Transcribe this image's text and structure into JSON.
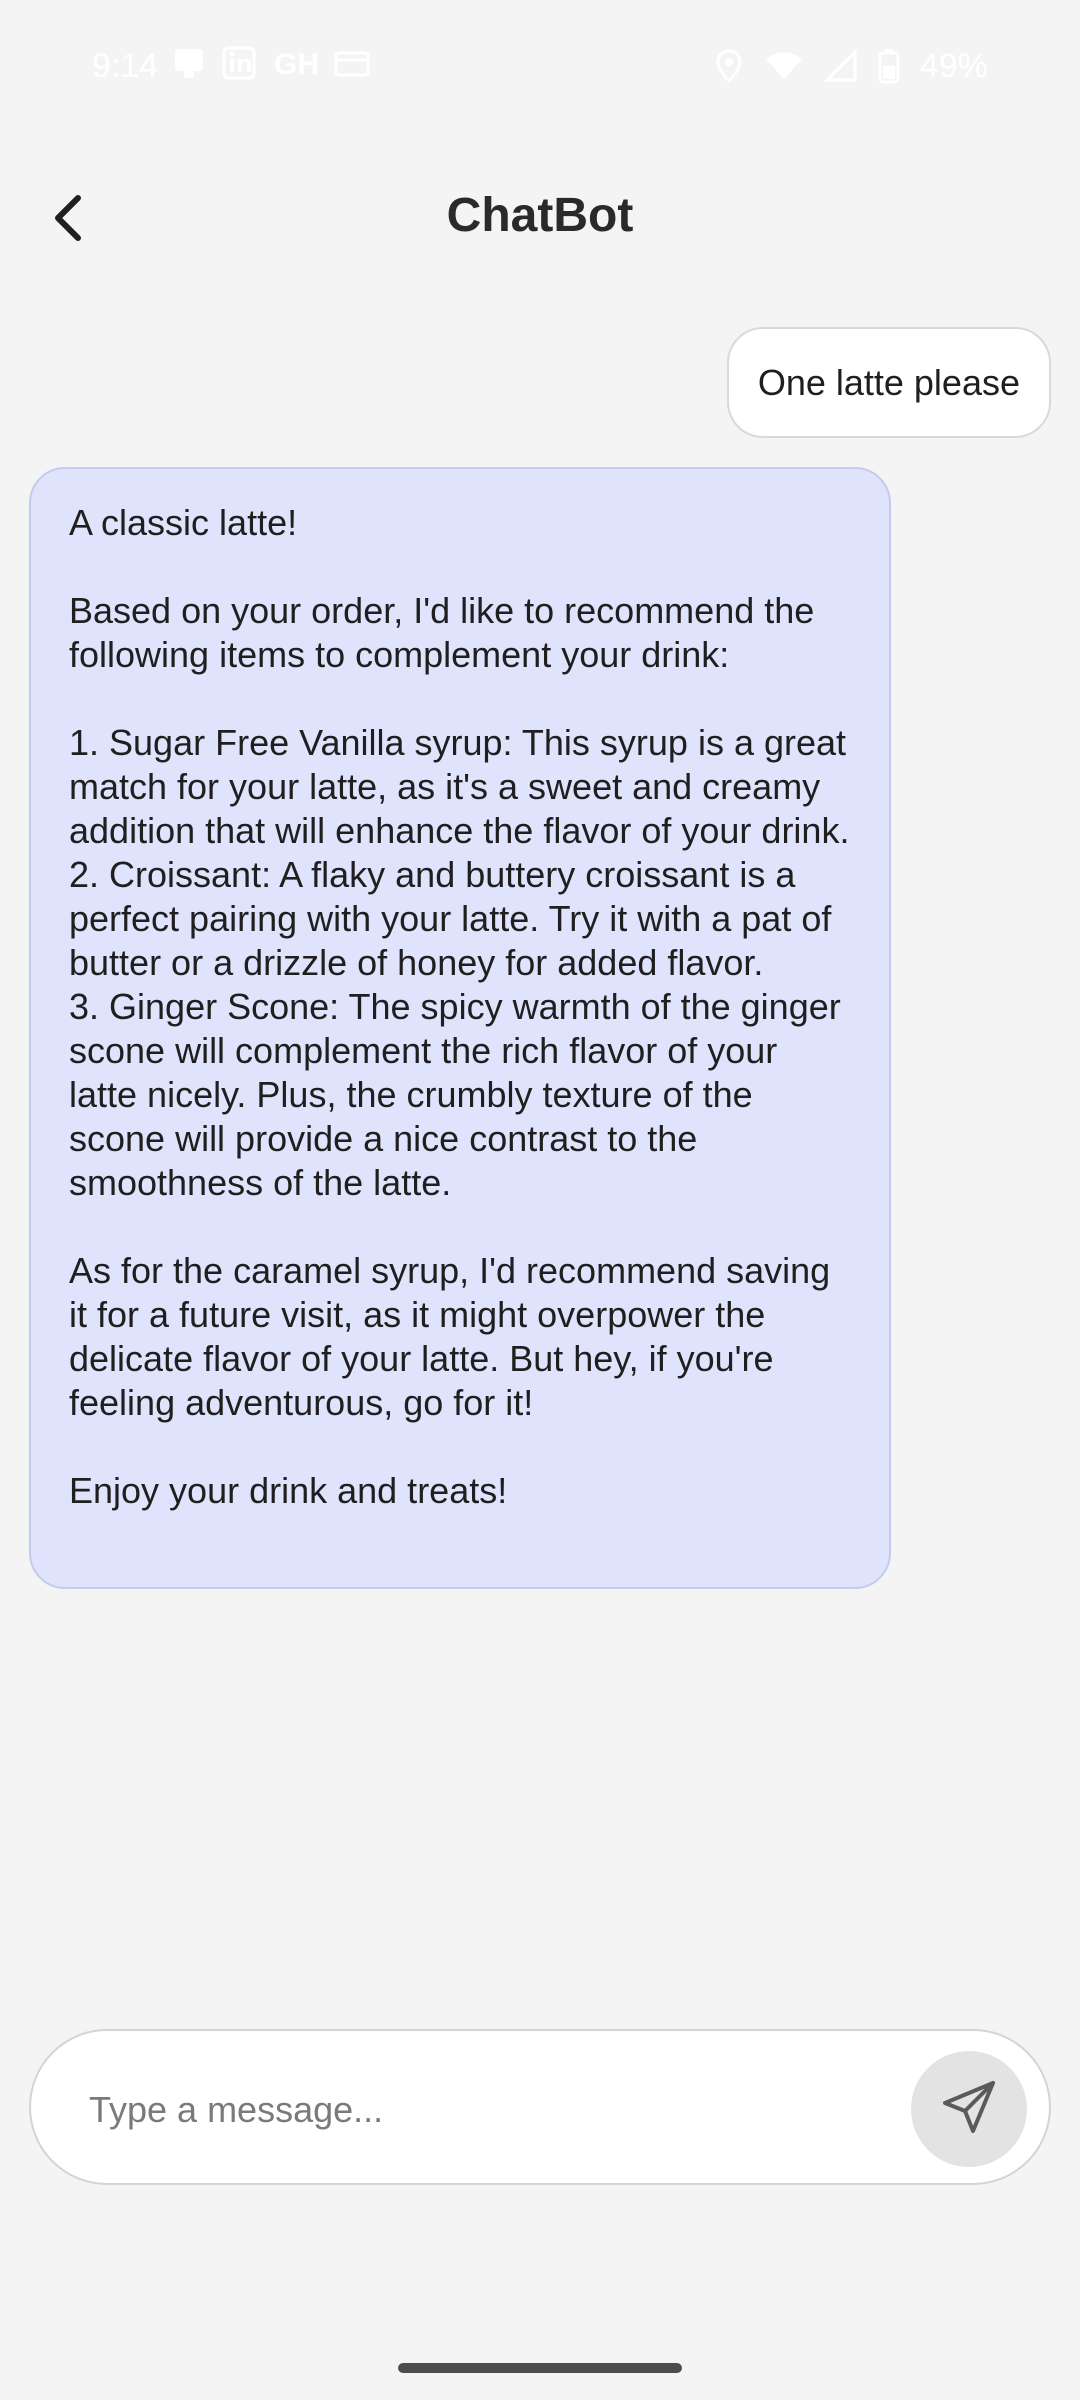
{
  "status_bar": {
    "time": "9:14",
    "left_icons": [
      "messaging-app-icon",
      "linkedin-icon",
      "github-icon",
      "card-icon"
    ],
    "right_icons": [
      "location-icon",
      "wifi-icon",
      "signal-icon",
      "battery-icon"
    ],
    "battery_percent": "49%"
  },
  "header": {
    "title": "ChatBot",
    "back_icon": "chevron-left-icon"
  },
  "messages": {
    "user": {
      "text": "One latte please"
    },
    "bot": {
      "p1": "A classic latte!",
      "p2": "Based on your order, I'd like to recommend the following items to complement your drink:",
      "item1": "1. Sugar Free Vanilla syrup: This syrup is a great match for your latte, as it's a sweet and creamy addition that will enhance the flavor of your drink.",
      "item2": "2. Croissant: A flaky and buttery croissant is a perfect pairing with your latte. Try it with a pat of butter or a drizzle of honey for added flavor.",
      "item3": "3. Ginger Scone: The spicy warmth of the ginger scone will complement the rich flavor of your latte nicely. Plus, the crumbly texture of the scone will provide a nice contrast to the smoothness of the latte.",
      "p4": "As for the caramel syrup, I'd recommend saving it for a future visit, as it might overpower the delicate flavor of your latte. But hey, if you're feeling adventurous, go for it!",
      "p5": "Enjoy your drink and treats!"
    }
  },
  "composer": {
    "placeholder": "Type a message...",
    "value": "",
    "send_icon": "send-icon"
  },
  "colors": {
    "background": "#f4f4f4",
    "bot_bubble": "#dfe3fb",
    "bot_bubble_border": "#c3cbf0",
    "user_bubble": "#ffffff",
    "send_button": "#e3e3e3"
  }
}
